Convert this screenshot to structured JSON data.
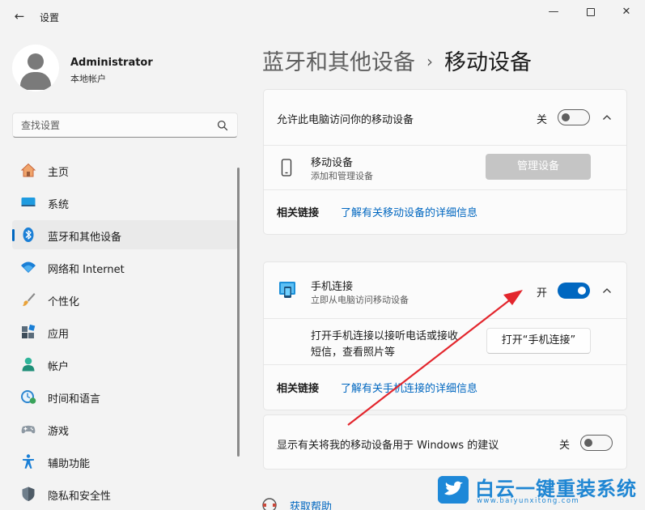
{
  "window": {
    "title": "设置",
    "back_glyph": "←",
    "minimize_glyph": "—",
    "close_glyph": "✕"
  },
  "user": {
    "name": "Administrator",
    "account_type": "本地帐户"
  },
  "search": {
    "placeholder": "查找设置"
  },
  "sidebar": {
    "items": [
      {
        "label": "主页",
        "icon": "home-icon",
        "active": false
      },
      {
        "label": "系统",
        "icon": "system-display-icon",
        "active": false
      },
      {
        "label": "蓝牙和其他设备",
        "icon": "bluetooth-icon",
        "active": true
      },
      {
        "label": "网络和 Internet",
        "icon": "wifi-icon",
        "active": false
      },
      {
        "label": "个性化",
        "icon": "paint-brush-icon",
        "active": false
      },
      {
        "label": "应用",
        "icon": "apps-icon",
        "active": false
      },
      {
        "label": "帐户",
        "icon": "account-icon",
        "active": false
      },
      {
        "label": "时间和语言",
        "icon": "time-language-icon",
        "active": false
      },
      {
        "label": "游戏",
        "icon": "gamepad-icon",
        "active": false
      },
      {
        "label": "辅助功能",
        "icon": "accessibility-icon",
        "active": false
      },
      {
        "label": "隐私和安全性",
        "icon": "shield-icon",
        "active": false
      }
    ]
  },
  "breadcrumb": {
    "parent": "蓝牙和其他设备",
    "separator": "›",
    "current": "移动设备"
  },
  "mobile_devices_card": {
    "allow_label": "允许此电脑访问你的移动设备",
    "allow_state_label": "关",
    "allow_toggle_on": false,
    "device_title": "移动设备",
    "device_subtitle": "添加和管理设备",
    "manage_button": "管理设备",
    "related_label": "相关链接",
    "related_link": "了解有关移动设备的详细信息"
  },
  "phone_link_card": {
    "title": "手机连接",
    "subtitle": "立即从电脑访问移动设备",
    "state_label": "开",
    "toggle_on": true,
    "description_line1": "打开手机连接以接听电话或接收",
    "description_line2": "短信，查看照片等",
    "open_button": "打开“手机连接”",
    "related_label": "相关链接",
    "related_link": "了解有关手机连接的详细信息"
  },
  "suggestions_card": {
    "label": "显示有关将我的移动设备用于 Windows 的建议",
    "state_label": "关",
    "toggle_on": false
  },
  "help": {
    "label": "获取帮助"
  },
  "watermark": {
    "brand": "白云一键重装系统",
    "url": "www.baiyunxitong.com"
  },
  "colors": {
    "accent": "#0067c0",
    "annotation_arrow": "#e3262d"
  }
}
